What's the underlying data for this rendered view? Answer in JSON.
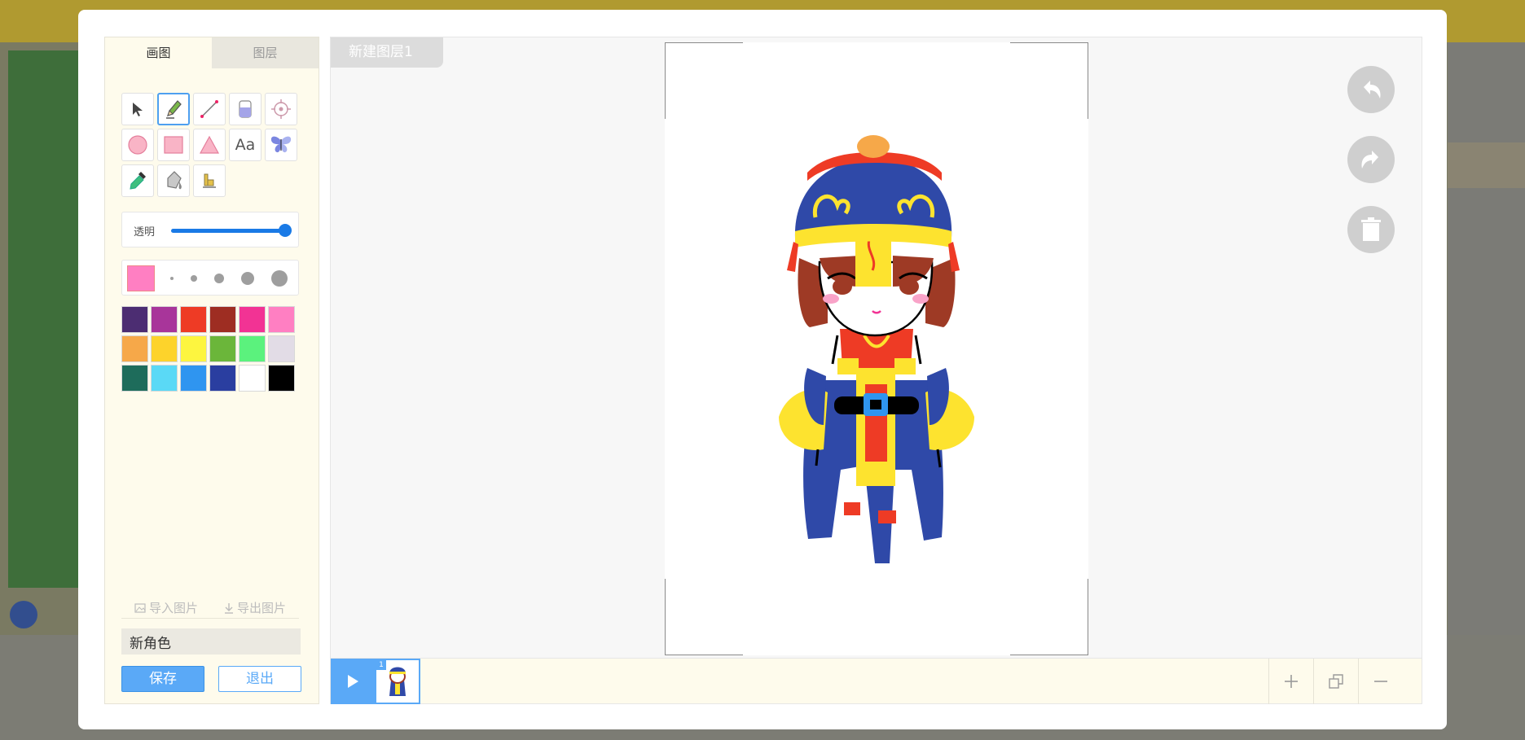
{
  "tabs": {
    "draw": "画图",
    "layers": "图层"
  },
  "tools": [
    {
      "name": "select-tool",
      "icon": "cursor-icon"
    },
    {
      "name": "pencil-tool",
      "icon": "pencil-icon",
      "active": true
    },
    {
      "name": "line-tool",
      "icon": "line-icon"
    },
    {
      "name": "eraser-tool",
      "icon": "eraser-icon"
    },
    {
      "name": "center-tool",
      "icon": "crosshair-icon"
    },
    {
      "name": "circle-tool",
      "icon": "circle-icon"
    },
    {
      "name": "rectangle-tool",
      "icon": "rectangle-icon"
    },
    {
      "name": "triangle-tool",
      "icon": "triangle-icon"
    },
    {
      "name": "text-tool",
      "icon": "text-icon",
      "label": "Aa"
    },
    {
      "name": "sticker-tool",
      "icon": "butterfly-icon"
    },
    {
      "name": "eyedropper-tool",
      "icon": "eyedropper-icon"
    },
    {
      "name": "fill-tool",
      "icon": "paint-bucket-icon"
    },
    {
      "name": "align-tool",
      "icon": "align-icon"
    }
  ],
  "opacity": {
    "label": "透明",
    "value": 1.0
  },
  "brush": {
    "current_color": "#ff7fc2",
    "size_levels": 5
  },
  "palette": [
    "#4c2d72",
    "#a8359a",
    "#ee3b25",
    "#9e2d22",
    "#f23394",
    "#ff7fc2",
    "#f6a849",
    "#fdd32b",
    "#fdf53f",
    "#6bb63a",
    "#5bf27d",
    "#e2dce6",
    "#1e6c5b",
    "#5ad9f6",
    "#2f95f0",
    "#2a3ea0",
    "#ffffff",
    "#000000"
  ],
  "import_label": "导入图片",
  "export_label": "导出图片",
  "role_name": "新角色",
  "save_label": "保存",
  "exit_label": "退出",
  "layer_name": "新建图层1",
  "frame": {
    "number": "1"
  }
}
